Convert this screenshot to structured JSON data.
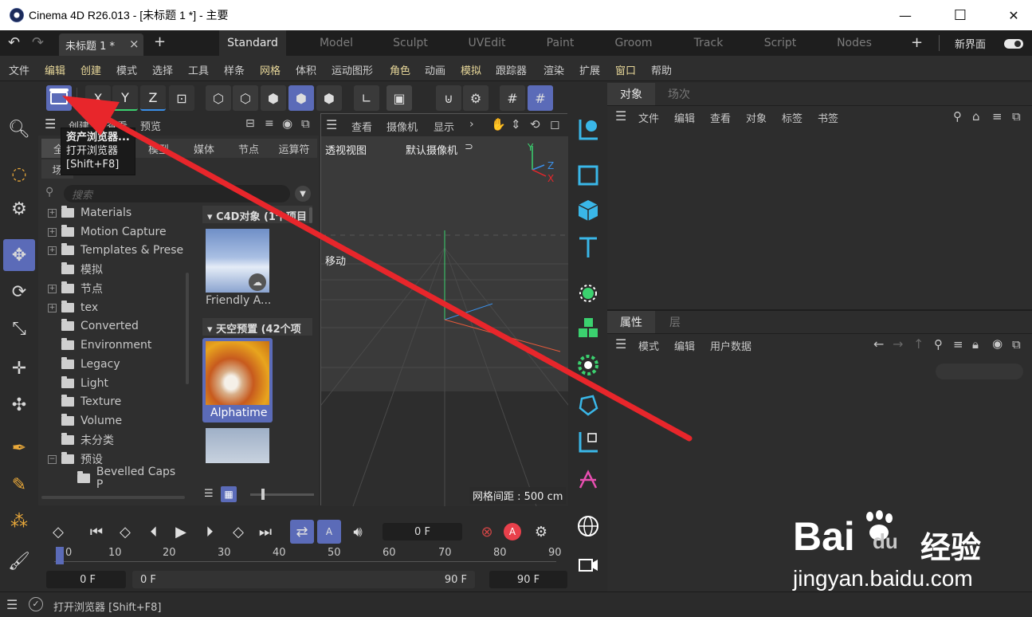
{
  "window": {
    "title": "Cinema 4D R26.013 - [未标题 1 *] - 主要",
    "minimize": "—",
    "maximize": "☐",
    "close": "✕"
  },
  "tabs": {
    "doc_tab": "未标题 1 *",
    "doc_close": "×",
    "add_tab": "+",
    "layouts": [
      "Standard",
      "Model",
      "Sculpt",
      "UVEdit",
      "Paint",
      "Groom",
      "Track",
      "Script",
      "Nodes"
    ],
    "add_layout": "+",
    "new_ui_label": "新界面"
  },
  "menubar": {
    "items": [
      "文件",
      "编辑",
      "创建",
      "模式",
      "选择",
      "工具",
      "样条",
      "网格",
      "体积",
      "运动图形",
      "角色",
      "动画",
      "模拟",
      "跟踪器",
      "渲染",
      "扩展",
      "窗口",
      "帮助"
    ]
  },
  "toolbar": {
    "axis_x": "X",
    "axis_y": "Y",
    "axis_z": "Z"
  },
  "tooltip": {
    "title": "资产浏览器...",
    "line1": "打开浏览器",
    "line2": "[Shift+F8]"
  },
  "asset_browser": {
    "menu_items": [
      "创建",
      "查看",
      "预览"
    ],
    "filter_tabs": [
      "全部",
      "模型",
      "媒体",
      "节点",
      "运算符"
    ],
    "second_row": "场",
    "search_placeholder": "搜索",
    "tree": [
      {
        "label": "Materials",
        "expandable": true,
        "indent": 0
      },
      {
        "label": "Motion Capture",
        "expandable": true,
        "indent": 0
      },
      {
        "label": "Templates & Prese",
        "expandable": true,
        "indent": 0
      },
      {
        "label": "模拟",
        "expandable": false,
        "indent": 0
      },
      {
        "label": "节点",
        "expandable": true,
        "indent": 0
      },
      {
        "label": "tex",
        "expandable": true,
        "indent": 0
      },
      {
        "label": "Converted",
        "expandable": false,
        "indent": 0
      },
      {
        "label": "Environment",
        "expandable": false,
        "indent": 0
      },
      {
        "label": "Legacy",
        "expandable": false,
        "indent": 0
      },
      {
        "label": "Light",
        "expandable": false,
        "indent": 0
      },
      {
        "label": "Texture",
        "expandable": false,
        "indent": 0
      },
      {
        "label": "Volume",
        "expandable": false,
        "indent": 0
      },
      {
        "label": "未分类",
        "expandable": false,
        "indent": 0
      },
      {
        "label": "预设",
        "expandable": true,
        "expanded": true,
        "indent": 0
      },
      {
        "label": "Bevelled Caps P",
        "expandable": false,
        "indent": 1
      }
    ],
    "section1_title": "C4D对象 (1个项目",
    "asset1_label": "Friendly A...",
    "section2_title": "天空预置 (42个项",
    "asset2_label": "Alphatime"
  },
  "viewport": {
    "menu_items": [
      "查看",
      "摄像机",
      "显示"
    ],
    "view_name": "透视视图",
    "camera_name": "默认摄像机",
    "move_label": "移动",
    "grid_spacing": "网格间距 : 500 cm",
    "axis_y": "Y",
    "axis_z": "Z",
    "axis_x": "X"
  },
  "object_panel": {
    "tabs": [
      "对象",
      "场次"
    ],
    "menu_items": [
      "文件",
      "编辑",
      "查看",
      "对象",
      "标签",
      "书签"
    ]
  },
  "attribute_panel": {
    "tabs": [
      "属性",
      "层"
    ],
    "menu_items": [
      "模式",
      "编辑",
      "用户数据"
    ]
  },
  "timeline": {
    "current_frame": "0 F",
    "start_field": "0 F",
    "range_start": "0 F",
    "range_end": "90 F",
    "end_field": "90 F",
    "ruler": [
      "0",
      "10",
      "20",
      "30",
      "40",
      "50",
      "60",
      "70",
      "80",
      "90"
    ],
    "record_label": "A"
  },
  "statusbar": {
    "text": "打开浏览器 [Shift+F8]"
  },
  "watermark": {
    "brand": "Bai",
    "brand2": "du",
    "cn": "经验",
    "url": "jingyan.baidu.com"
  },
  "colors": {
    "accent": "#5b6bb8",
    "arrow": "#e8262b",
    "menu_highlight": "#e8d89a",
    "green_tool": "#3bd16f",
    "cyan_tool": "#3ab7e8"
  }
}
